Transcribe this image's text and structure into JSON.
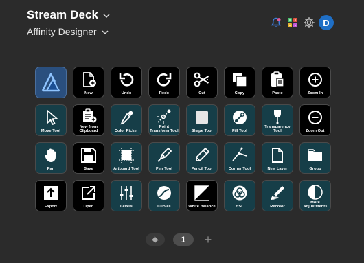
{
  "header": {
    "device": "Stream Deck",
    "profile": "Affinity Designer"
  },
  "top_icons": [
    "bell-notification-icon",
    "plugins-icon",
    "settings-gear-icon"
  ],
  "avatar_initial": "D",
  "keys": [
    {
      "label": "",
      "icon": "affinity-designer-logo"
    },
    {
      "label": "New",
      "icon": "new-document-icon"
    },
    {
      "label": "Undo",
      "icon": "undo-icon"
    },
    {
      "label": "Redo",
      "icon": "redo-icon"
    },
    {
      "label": "Cut",
      "icon": "scissors-icon"
    },
    {
      "label": "Copy",
      "icon": "copy-icon"
    },
    {
      "label": "Paste",
      "icon": "clipboard-icon"
    },
    {
      "label": "Zoom In",
      "icon": "zoom-in-icon"
    },
    {
      "label": "Move Tool",
      "icon": "cursor-icon"
    },
    {
      "label": "New from Clipboard",
      "icon": "clipboard-new-icon"
    },
    {
      "label": "Color Picker",
      "icon": "eyedropper-icon"
    },
    {
      "label": "Point Transform Tool",
      "icon": "point-transform-icon"
    },
    {
      "label": "Shape Tool",
      "icon": "square-shape-icon"
    },
    {
      "label": "Fill Tool",
      "icon": "fill-icon"
    },
    {
      "label": "Transparency Tool",
      "icon": "transparency-icon"
    },
    {
      "label": "Zoom Out",
      "icon": "zoom-out-icon"
    },
    {
      "label": "Pan",
      "icon": "hand-icon"
    },
    {
      "label": "Save",
      "icon": "floppy-disk-icon"
    },
    {
      "label": "Artboard Tool",
      "icon": "artboard-icon"
    },
    {
      "label": "Pen Tool",
      "icon": "pen-nib-icon"
    },
    {
      "label": "Pencil Tool",
      "icon": "pencil-icon"
    },
    {
      "label": "Corner Tool",
      "icon": "corner-node-icon"
    },
    {
      "label": "New Layer",
      "icon": "new-layer-icon"
    },
    {
      "label": "Group",
      "icon": "folder-icon"
    },
    {
      "label": "Export",
      "icon": "export-icon"
    },
    {
      "label": "Open",
      "icon": "open-external-icon"
    },
    {
      "label": "Levels",
      "icon": "levels-sliders-icon"
    },
    {
      "label": "Curves",
      "icon": "curves-icon"
    },
    {
      "label": "White Balance",
      "icon": "white-balance-icon"
    },
    {
      "label": "HSL",
      "icon": "hsl-circles-icon"
    },
    {
      "label": "Recolor",
      "icon": "recolor-icon"
    },
    {
      "label": "More Adjustments",
      "icon": "more-adjustments-icon"
    }
  ],
  "pages": {
    "current": "1",
    "pin_icon": "pin-icon",
    "add_icon": "add-page-icon",
    "add_label": "+"
  }
}
